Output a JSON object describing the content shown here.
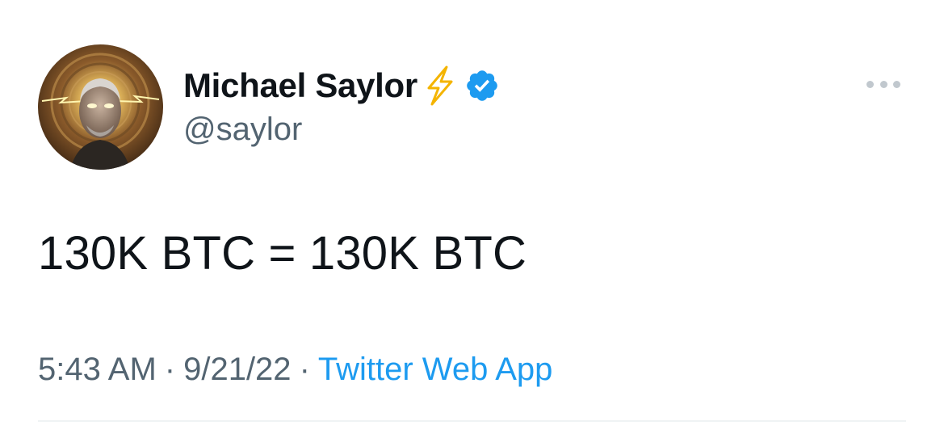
{
  "tweet": {
    "author": {
      "display_name": "Michael Saylor",
      "handle": "@saylor",
      "name_emoji": "lightning-bolt",
      "verified": true,
      "avatar_icon": "profile-photo"
    },
    "text": "130K BTC = 130K BTC",
    "time": "5:43 AM",
    "date": "9/21/22",
    "separator": "·",
    "source": "Twitter Web App",
    "more_icon": "more-horizontal-icon"
  },
  "colors": {
    "text_primary": "#0f1419",
    "text_secondary": "#536471",
    "link": "#1d9bf0",
    "verified": "#1d9bf0",
    "bolt": "#f4b400",
    "divider": "#eff3f4",
    "more_dots": "#c1c8ce"
  }
}
